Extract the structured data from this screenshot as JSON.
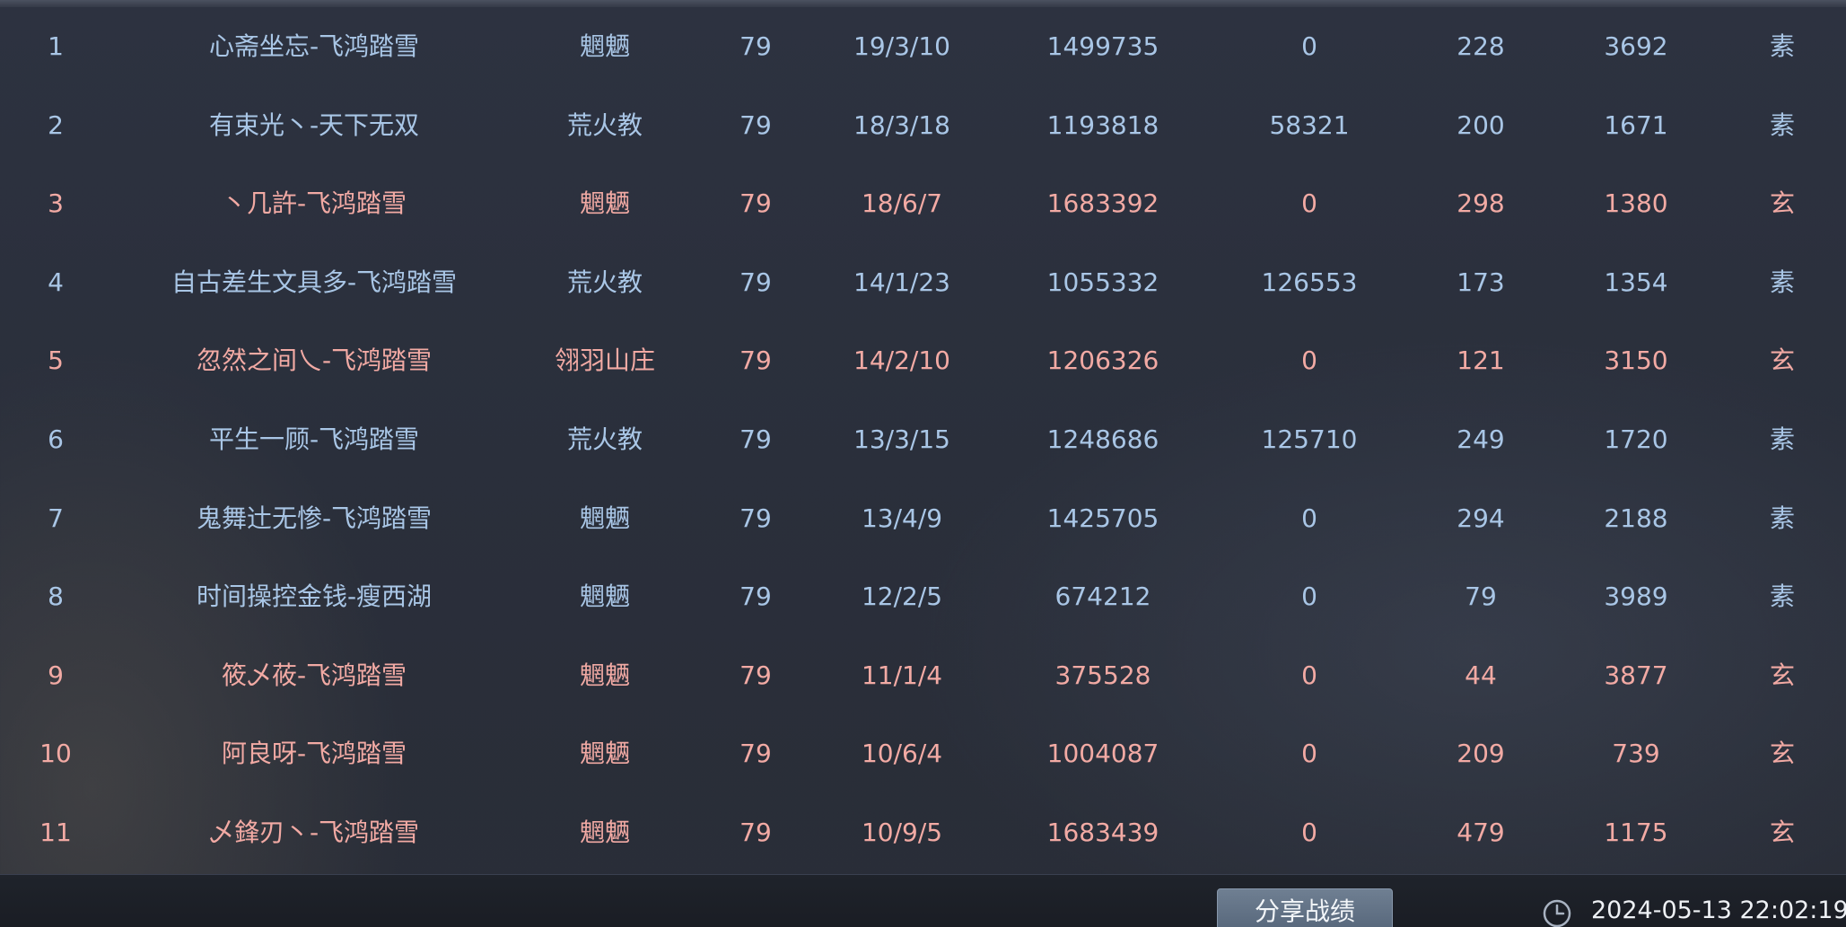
{
  "theme": {
    "blue_text": "#a9c6e6",
    "pink_text": "#f2aaa4",
    "background": "#2b303c"
  },
  "rows": [
    {
      "rank": "1",
      "name": "心斋坐忘-飞鸿踏雪",
      "sect": "魍魉",
      "level": "79",
      "date": "19/3/10",
      "v1": "1499735",
      "v2": "0",
      "v3": "228",
      "v4": "3692",
      "type": "素",
      "color": "blue"
    },
    {
      "rank": "2",
      "name": "有束光丶-天下无双",
      "sect": "荒火教",
      "level": "79",
      "date": "18/3/18",
      "v1": "1193818",
      "v2": "58321",
      "v3": "200",
      "v4": "1671",
      "type": "素",
      "color": "blue"
    },
    {
      "rank": "3",
      "name": "丶几許-飞鸿踏雪",
      "sect": "魍魉",
      "level": "79",
      "date": "18/6/7",
      "v1": "1683392",
      "v2": "0",
      "v3": "298",
      "v4": "1380",
      "type": "玄",
      "color": "pink"
    },
    {
      "rank": "4",
      "name": "自古差生文具多-飞鸿踏雪",
      "sect": "荒火教",
      "level": "79",
      "date": "14/1/23",
      "v1": "1055332",
      "v2": "126553",
      "v3": "173",
      "v4": "1354",
      "type": "素",
      "color": "blue"
    },
    {
      "rank": "5",
      "name": "忽然之间乀-飞鸿踏雪",
      "sect": "翎羽山庄",
      "level": "79",
      "date": "14/2/10",
      "v1": "1206326",
      "v2": "0",
      "v3": "121",
      "v4": "3150",
      "type": "玄",
      "color": "pink"
    },
    {
      "rank": "6",
      "name": "平生一顾-飞鸿踏雪",
      "sect": "荒火教",
      "level": "79",
      "date": "13/3/15",
      "v1": "1248686",
      "v2": "125710",
      "v3": "249",
      "v4": "1720",
      "type": "素",
      "color": "blue"
    },
    {
      "rank": "7",
      "name": "鬼舞辻无惨-飞鸿踏雪",
      "sect": "魍魉",
      "level": "79",
      "date": "13/4/9",
      "v1": "1425705",
      "v2": "0",
      "v3": "294",
      "v4": "2188",
      "type": "素",
      "color": "blue"
    },
    {
      "rank": "8",
      "name": "时间操控金钱-瘦西湖",
      "sect": "魍魉",
      "level": "79",
      "date": "12/2/5",
      "v1": "674212",
      "v2": "0",
      "v3": "79",
      "v4": "3989",
      "type": "素",
      "color": "blue"
    },
    {
      "rank": "9",
      "name": "筱乄莜-飞鸿踏雪",
      "sect": "魍魉",
      "level": "79",
      "date": "11/1/4",
      "v1": "375528",
      "v2": "0",
      "v3": "44",
      "v4": "3877",
      "type": "玄",
      "color": "pink"
    },
    {
      "rank": "10",
      "name": "阿良呀-飞鸿踏雪",
      "sect": "魍魉",
      "level": "79",
      "date": "10/6/4",
      "v1": "1004087",
      "v2": "0",
      "v3": "209",
      "v4": "739",
      "type": "玄",
      "color": "pink"
    },
    {
      "rank": "11",
      "name": "乄鋒刃丶-飞鸿踏雪",
      "sect": "魍魉",
      "level": "79",
      "date": "10/9/5",
      "v1": "1683439",
      "v2": "0",
      "v3": "479",
      "v4": "1175",
      "type": "玄",
      "color": "pink"
    }
  ],
  "footer": {
    "share_label": "分享战绩",
    "clock_icon": "clock-icon",
    "timestamp": "2024-05-13 22:02:19"
  }
}
